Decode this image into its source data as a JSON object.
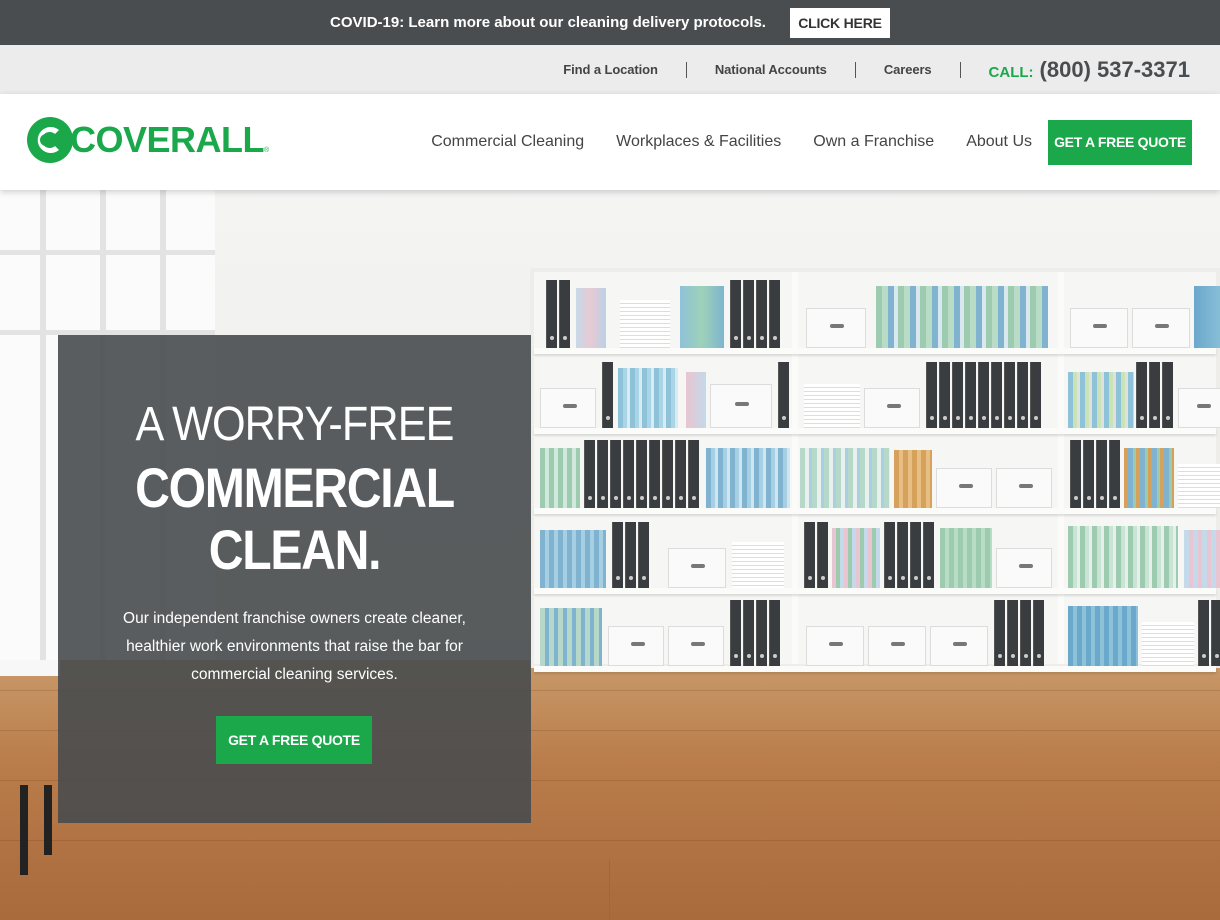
{
  "banner": {
    "message": "COVID-19: Learn more about our cleaning delivery protocols.",
    "button_label": "CLICK HERE"
  },
  "utility": {
    "links": [
      "Find a Location",
      "National Accounts",
      "Careers"
    ],
    "call_label": "CALL:",
    "phone": "(800) 537-3371"
  },
  "header": {
    "logo_text": "COVERALL",
    "logo_reg": "®",
    "nav": [
      "Commercial Cleaning",
      "Workplaces & Facilities",
      "Own a Franchise",
      "About Us"
    ],
    "cta_label": "GET A FREE QUOTE"
  },
  "hero": {
    "line1": "A WORRY-FREE",
    "line2": "COMMERCIAL",
    "line3": "CLEAN.",
    "body": "Our independent franchise owners create cleaner, healthier work environments that raise the bar for commercial cleaning services.",
    "cta_label": "GET A FREE QUOTE"
  },
  "colors": {
    "brand_green": "#1aa84b",
    "banner_bg": "#4a4d4f",
    "utility_bg": "#ececec"
  }
}
